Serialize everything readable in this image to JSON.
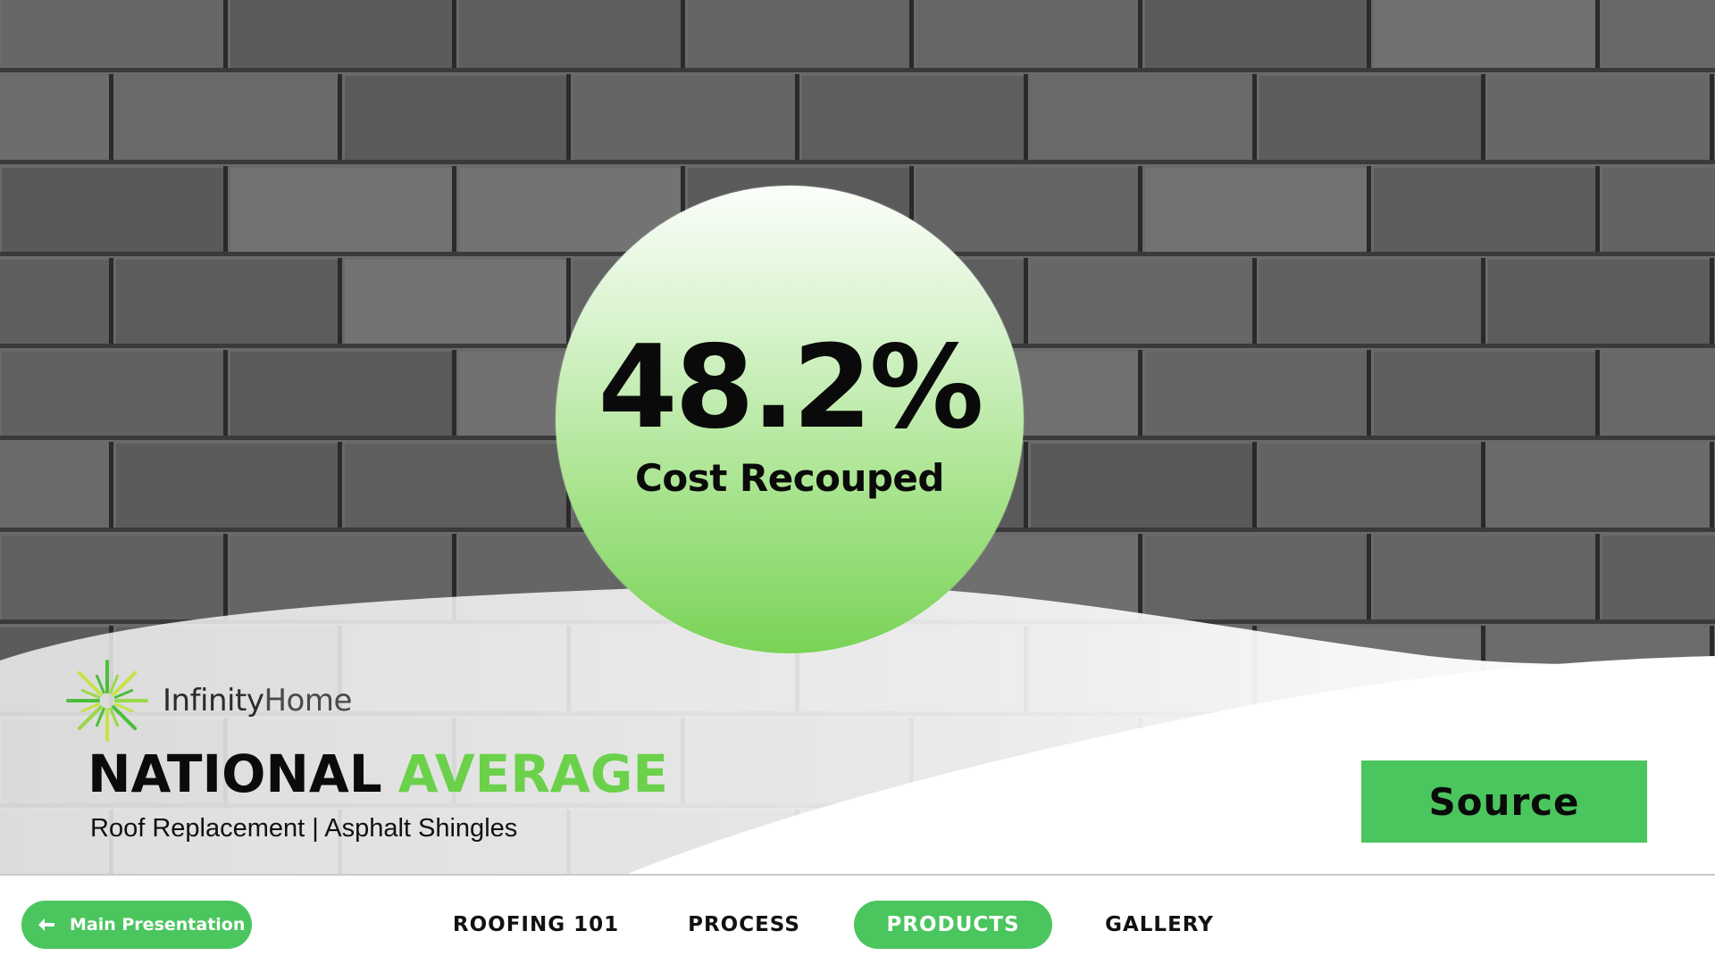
{
  "stat": {
    "value": "48.2%",
    "label": "Cost Recouped"
  },
  "brand": {
    "name_part1": "Infinity",
    "name_part2": "Home"
  },
  "headline": {
    "word1": "NATIONAL",
    "word2": "AVERAGE",
    "subtitle": "Roof Replacement | Asphalt Shingles"
  },
  "source_button": "Source",
  "nav": {
    "back_label": "Main Presentation",
    "items": [
      {
        "label": "ROOFING 101",
        "active": false
      },
      {
        "label": "PROCESS",
        "active": false
      },
      {
        "label": "PRODUCTS",
        "active": true
      },
      {
        "label": "GALLERY",
        "active": false
      }
    ]
  },
  "colors": {
    "accent_green": "#4bc55e",
    "headline_green": "#6bd14a",
    "shingle_gray": "#6a6a6a"
  },
  "icons": {
    "back": "arrow-left-icon",
    "logo": "starburst-logo-icon"
  }
}
